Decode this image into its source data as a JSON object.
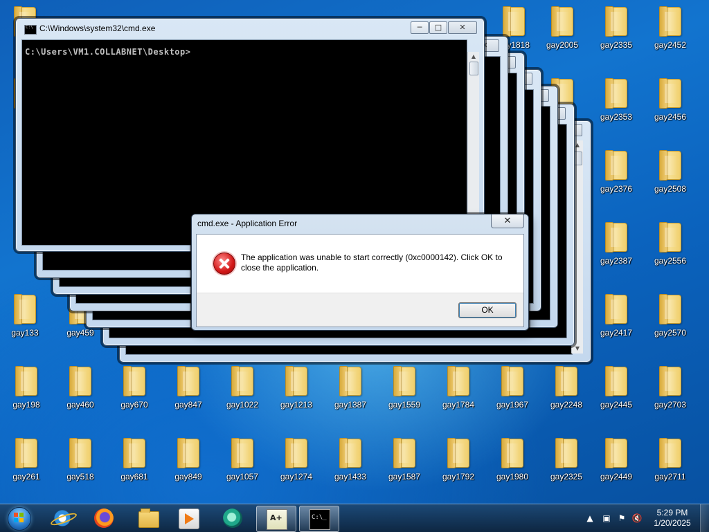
{
  "desktop": {
    "icons": [
      {
        "label": "gay1818"
      },
      {
        "label": "gay2005"
      },
      {
        "label": "gay2335"
      },
      {
        "label": "gay2452"
      },
      {
        "label": "gay2353"
      },
      {
        "label": "gay2456"
      },
      {
        "label": "gay2376"
      },
      {
        "label": "gay2508"
      },
      {
        "label": "gay2387"
      },
      {
        "label": "gay2556"
      },
      {
        "label": "gay133"
      },
      {
        "label": "gay459"
      },
      {
        "label": "gay2417"
      },
      {
        "label": "gay2570"
      },
      {
        "label": "gay198"
      },
      {
        "label": "gay460"
      },
      {
        "label": "gay670"
      },
      {
        "label": "gay847"
      },
      {
        "label": "gay1022"
      },
      {
        "label": "gay1213"
      },
      {
        "label": "gay1387"
      },
      {
        "label": "gay1559"
      },
      {
        "label": "gay1784"
      },
      {
        "label": "gay1967"
      },
      {
        "label": "gay2248"
      },
      {
        "label": "gay2445"
      },
      {
        "label": "gay2703"
      },
      {
        "label": "gay261"
      },
      {
        "label": "gay518"
      },
      {
        "label": "gay681"
      },
      {
        "label": "gay849"
      },
      {
        "label": "gay1057"
      },
      {
        "label": "gay1274"
      },
      {
        "label": "gay1433"
      },
      {
        "label": "gay1587"
      },
      {
        "label": "gay1792"
      },
      {
        "label": "gay1980"
      },
      {
        "label": "gay2325"
      },
      {
        "label": "gay2449"
      },
      {
        "label": "gay2711"
      }
    ]
  },
  "cmd_window": {
    "title": "C:\\Windows\\system32\\cmd.exe",
    "prompt": "C:\\Users\\VM1.COLLABNET\\Desktop>",
    "minimize": "─",
    "maximize": "□",
    "close": "✕"
  },
  "error_dialog": {
    "title": "cmd.exe - Application Error",
    "close_label": "✕",
    "message": "The application was unable to start correctly (0xc0000142). Click OK to close the application.",
    "ok_label": "OK"
  },
  "taskbar": {
    "pinned": [
      {
        "name": "internet-explorer",
        "icon": "ie-icon"
      },
      {
        "name": "firefox",
        "icon": "firefox-icon"
      },
      {
        "name": "windows-explorer",
        "icon": "folder-icon"
      },
      {
        "name": "media-player",
        "icon": "media-player-icon"
      },
      {
        "name": "media-center",
        "icon": "media-center-icon"
      },
      {
        "name": "notepad-plus-plus",
        "icon": "notepad-icon"
      },
      {
        "name": "command-prompt",
        "icon": "cmd-icon"
      }
    ],
    "clock": {
      "time": "5:29 PM",
      "date": "1/20/2025"
    }
  }
}
